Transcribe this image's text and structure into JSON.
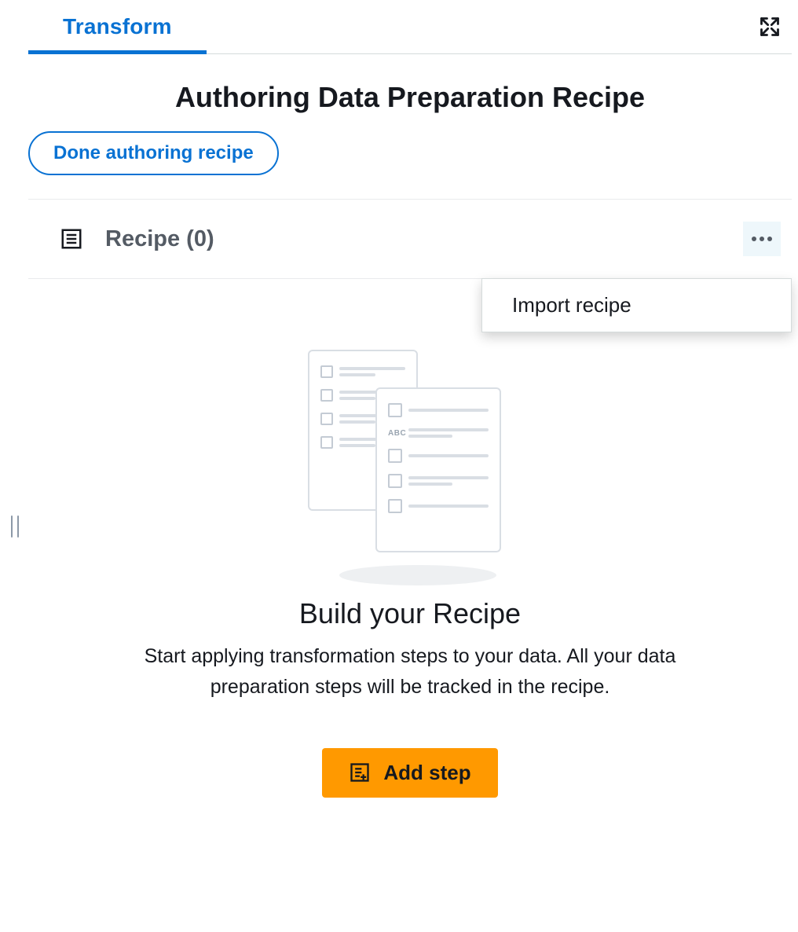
{
  "tab": {
    "label": "Transform"
  },
  "header": {
    "title": "Authoring Data Preparation Recipe",
    "done_button": "Done authoring recipe"
  },
  "recipe": {
    "title": "Recipe (0)",
    "menu": {
      "import_label": "Import recipe"
    }
  },
  "empty_state": {
    "title": "Build your Recipe",
    "description": "Start applying transformation steps to your data. All your data preparation steps will be tracked in the recipe.",
    "add_step_label": "Add step"
  }
}
